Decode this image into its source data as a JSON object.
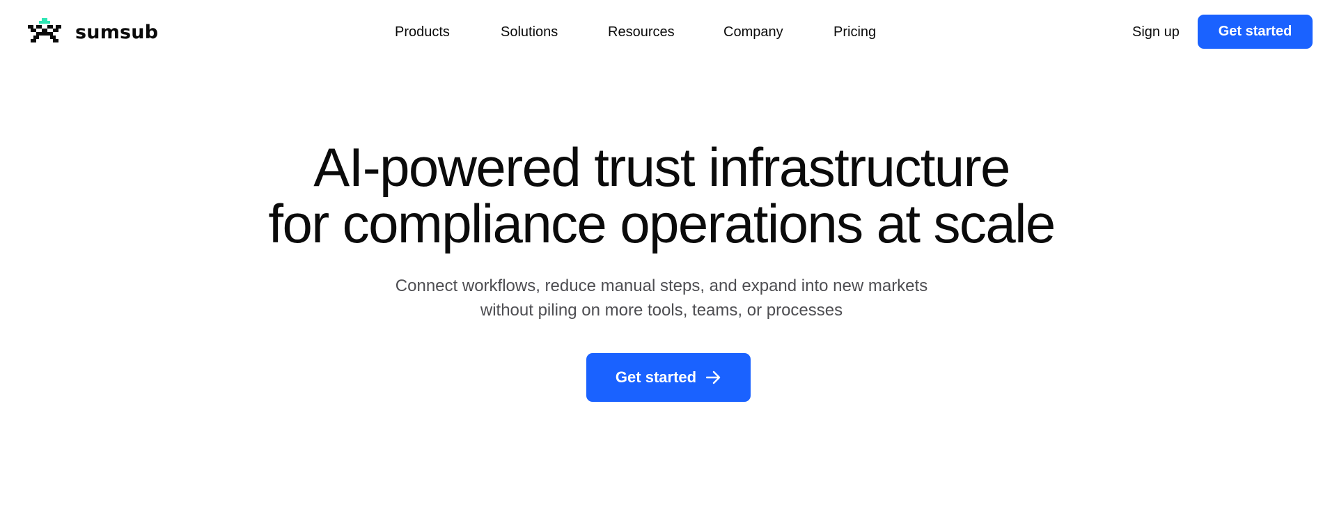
{
  "brand": {
    "name": "sumsub",
    "logo_icon": "pixel-creature-logo-icon",
    "accent_teal": "#2ee6b4"
  },
  "nav": {
    "items": [
      {
        "label": "Products"
      },
      {
        "label": "Solutions"
      },
      {
        "label": "Resources"
      },
      {
        "label": "Company"
      },
      {
        "label": "Pricing"
      }
    ],
    "signup_label": "Sign up",
    "cta_label": "Get started"
  },
  "hero": {
    "title_line1": "AI-powered trust infrastructure",
    "title_line2": "for compliance operations at scale",
    "subtitle_line1": "Connect workflows, reduce manual steps, and expand into new markets",
    "subtitle_line2": "without piling on more tools, teams, or processes",
    "cta_label": "Get started",
    "cta_icon": "arrow-right-icon"
  },
  "colors": {
    "primary": "#1a62ff",
    "text": "#0b0b0b",
    "muted": "#4e4e52",
    "background": "#ffffff"
  }
}
